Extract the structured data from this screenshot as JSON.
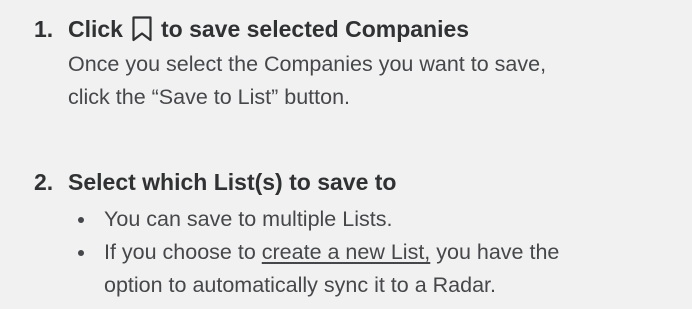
{
  "steps": [
    {
      "number": "1.",
      "title_before_icon": "Click",
      "icon": "bookmark-icon",
      "title_after_icon": "to save selected Companies",
      "body_line_1": "Once you select the Companies you want to save,",
      "body_line_2": "click the “Save to List” button."
    },
    {
      "number": "2.",
      "title": "Select which List(s) to save to",
      "bullets": [
        {
          "text": "You can save to multiple Lists."
        },
        {
          "text_before_link": "If you choose to ",
          "link_text": "create a new List,",
          "text_after_link": " you have the",
          "text_line_2": "option to automatically sync it to a Radar."
        }
      ]
    }
  ]
}
